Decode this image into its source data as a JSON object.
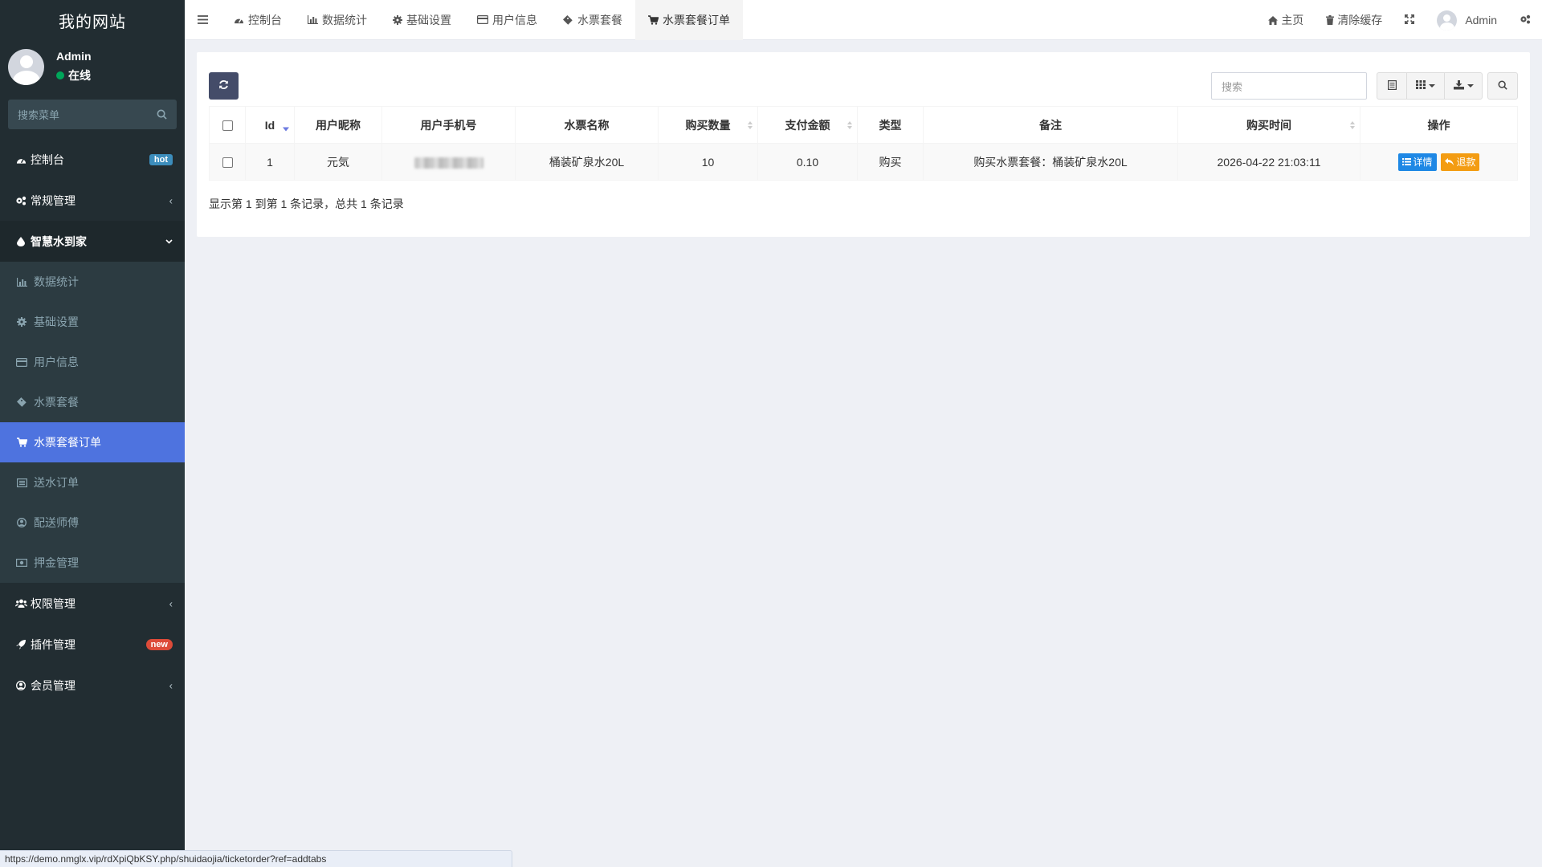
{
  "sidebar": {
    "brand": "我的网站",
    "user": {
      "name": "Admin",
      "status": "在线"
    },
    "search_placeholder": "搜索菜单",
    "menu": [
      {
        "label": "控制台",
        "badge": "hot"
      },
      {
        "label": "常规管理"
      },
      {
        "label": "智慧水到家"
      },
      {
        "label": "权限管理"
      },
      {
        "label": "插件管理",
        "badge": "new"
      },
      {
        "label": "会员管理"
      }
    ],
    "submenu": [
      {
        "label": "数据统计"
      },
      {
        "label": "基础设置"
      },
      {
        "label": "用户信息"
      },
      {
        "label": "水票套餐"
      },
      {
        "label": "水票套餐订单"
      },
      {
        "label": "送水订单"
      },
      {
        "label": "配送师傅"
      },
      {
        "label": "押金管理"
      }
    ]
  },
  "topbar": {
    "tabs": [
      {
        "label": "控制台"
      },
      {
        "label": "数据统计"
      },
      {
        "label": "基础设置"
      },
      {
        "label": "用户信息"
      },
      {
        "label": "水票套餐"
      },
      {
        "label": "水票套餐订单"
      }
    ],
    "right": {
      "home": "主页",
      "clear_cache": "清除缓存",
      "user": "Admin"
    }
  },
  "table": {
    "search_placeholder": "搜索",
    "columns": [
      "Id",
      "用户昵称",
      "用户手机号",
      "水票名称",
      "购买数量",
      "支付金额",
      "类型",
      "备注",
      "购买时间",
      "操作"
    ],
    "rows": [
      {
        "id": "1",
        "nickname": "元気",
        "ticket_name": "桶装矿泉水20L",
        "quantity": "10",
        "amount": "0.10",
        "type": "购买",
        "remark": "购买水票套餐：桶装矿泉水20L",
        "time": "2026-04-22 21:03:11"
      }
    ],
    "actions": {
      "detail": "详情",
      "refund": "退款"
    },
    "pagination": "显示第 1 到第 1 条记录，总共 1 条记录"
  },
  "statusbar": {
    "url": "https://demo.nmglx.vip/rdXpiQbKSY.php/shuidaojia/ticketorder?ref=addtabs"
  },
  "colors": {
    "sidebar_bg": "#222d32",
    "active": "#4e73df",
    "refresh_btn": "#444c69",
    "detail_btn": "#1e88e5",
    "refund_btn": "#f39c12"
  }
}
